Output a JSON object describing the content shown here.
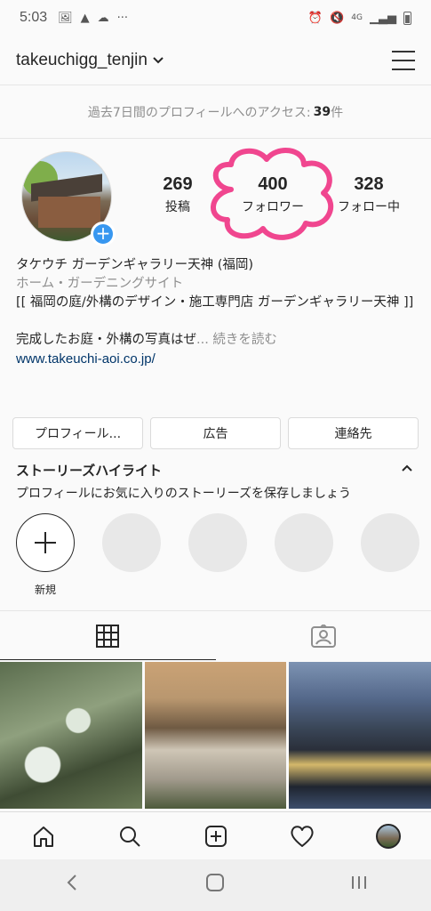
{
  "status_bar": {
    "time": "5:03",
    "left_icons": [
      "image-icon",
      "drive-icon",
      "cloud-icon",
      "more-dots-icon"
    ],
    "right_icons": [
      "alarm-icon",
      "mute-icon",
      "4g-icon",
      "signal-icon",
      "battery-icon"
    ],
    "network": "4G"
  },
  "header": {
    "username": "takeuchigg_tenjin"
  },
  "insights": {
    "text": "過去7日間のプロフィールへのアクセス:",
    "count": "39",
    "unit": "件"
  },
  "stats": {
    "posts": {
      "value": "269",
      "label": "投稿"
    },
    "followers": {
      "value": "400",
      "label": "フォロワー"
    },
    "following": {
      "value": "328",
      "label": "フォロー中"
    }
  },
  "annotation_color": "#f0468f",
  "bio": {
    "name": "タケウチ ガーデンギャラリー天神 (福岡)",
    "category": "ホーム・ガーデニングサイト",
    "desc": "[[ 福岡の庭/外構のデザイン・施工専門店 ガーデンギャラリー天神 ]]",
    "more_text": "完成したお庭・外構の写真はぜ",
    "more_link": "... 続きを読む",
    "website": "www.takeuchi-aoi.co.jp/"
  },
  "actions": {
    "profile": "プロフィール...",
    "ads": "広告",
    "contact": "連絡先"
  },
  "highlights": {
    "title": "ストーリーズハイライト",
    "subtitle": "プロフィールにお気に入りのストーリーズを保存しましょう",
    "new_label": "新規"
  },
  "tabs": [
    "grid-icon",
    "tagged-icon"
  ],
  "bottom_nav": [
    "home-icon",
    "search-icon",
    "add-post-icon",
    "heart-icon",
    "profile-avatar"
  ],
  "colors": {
    "link": "#003569",
    "accent_blue": "#3897f0",
    "muted": "#8e8e8e"
  }
}
